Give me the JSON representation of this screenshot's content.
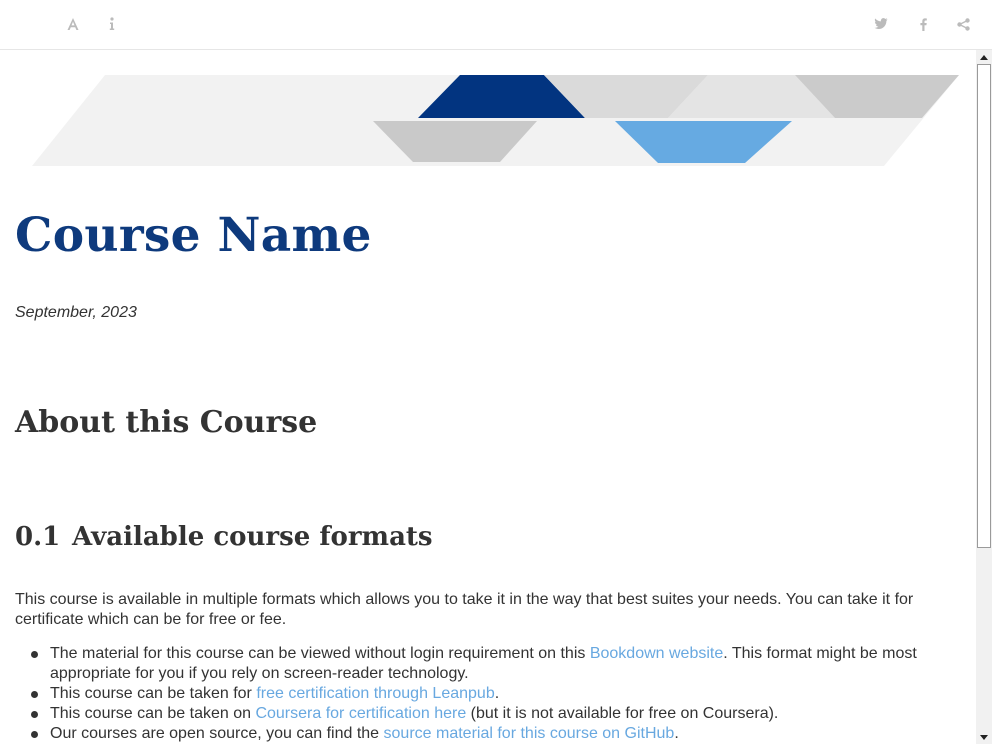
{
  "toolbar": {
    "icons": [
      "font-settings-icon",
      "info-icon",
      "twitter-icon",
      "facebook-icon",
      "share-icon"
    ]
  },
  "colors": {
    "title": "#0e3a7d",
    "link": "#68a8e0",
    "banner_dark_blue": "#023480",
    "banner_light_blue": "#66aae2",
    "banner_gray": "#cccccc",
    "banner_light_gray": "#f2f2f2"
  },
  "content": {
    "title": "Course Name",
    "date": "September, 2023",
    "about_heading": "About this Course",
    "section_number": "0.1",
    "section_title": "Available course formats",
    "intro": "This course is available in multiple formats which allows you to take it in the way that best suites your needs. You can take it for certificate which can be for free or fee.",
    "items": [
      {
        "before": "The material for this course can be viewed without login requirement on this ",
        "link": "Bookdown website",
        "after": ". This format might be most appropriate for you if you rely on screen-reader technology."
      },
      {
        "before": "This course can be taken for ",
        "link": "free certification through Leanpub",
        "after": "."
      },
      {
        "before": "This course can be taken on ",
        "link": "Coursera for certification here",
        "after": " (but it is not available for free on Coursera)."
      },
      {
        "before": "Our courses are open source, you can find the ",
        "link": "source material for this course on GitHub",
        "after": "."
      }
    ]
  }
}
